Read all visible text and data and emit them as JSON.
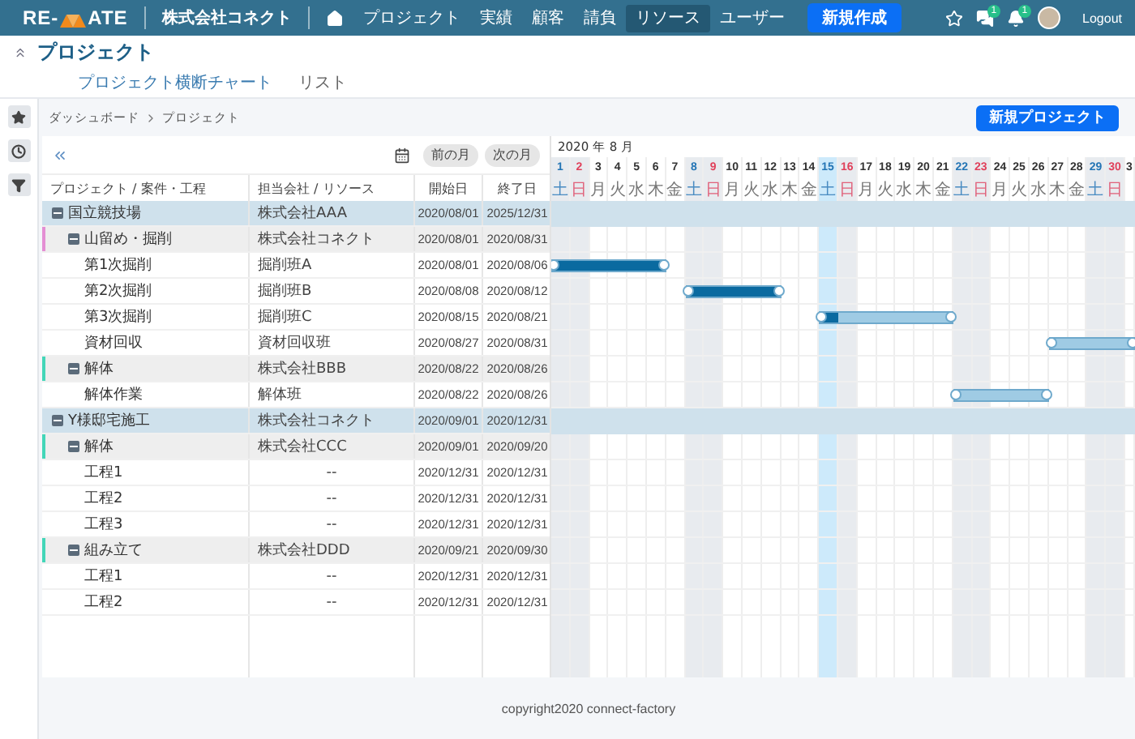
{
  "header": {
    "logo": {
      "left": "RE-",
      "right": "ATE"
    },
    "company": "株式会社コネクト",
    "nav": [
      {
        "label": "プロジェクト",
        "selected": false
      },
      {
        "label": "実績",
        "selected": false
      },
      {
        "label": "顧客",
        "selected": false
      },
      {
        "label": "請負",
        "selected": false
      },
      {
        "label": "リソース",
        "selected": true
      },
      {
        "label": "ユーザー",
        "selected": false
      }
    ],
    "create_button": "新規作成",
    "chat_badge": "1",
    "bell_badge": "1",
    "logout": "Logout"
  },
  "page": {
    "title": "プロジェクト",
    "tabs": [
      {
        "label": "プロジェクト横断チャート",
        "selected": true
      },
      {
        "label": "リスト",
        "selected": false
      }
    ]
  },
  "breadcrumb": [
    "ダッシュボード",
    "プロジェクト"
  ],
  "new_project_button": "新規プロジェクト",
  "toolbar": {
    "prev": "前の月",
    "next": "次の月"
  },
  "columns": [
    "プロジェクト / 案件・工程",
    "担当会社 / リソース",
    "開始日",
    "終了日"
  ],
  "month_label": "2020 年 8 月",
  "days": [
    {
      "day": "1",
      "weekday": "土",
      "kind": "saturday",
      "today": false
    },
    {
      "day": "2",
      "weekday": "日",
      "kind": "sunday",
      "today": false
    },
    {
      "day": "3",
      "weekday": "月",
      "kind": "weekday",
      "today": false
    },
    {
      "day": "4",
      "weekday": "火",
      "kind": "weekday",
      "today": false
    },
    {
      "day": "5",
      "weekday": "水",
      "kind": "weekday",
      "today": false
    },
    {
      "day": "6",
      "weekday": "木",
      "kind": "weekday",
      "today": false
    },
    {
      "day": "7",
      "weekday": "金",
      "kind": "weekday",
      "today": false
    },
    {
      "day": "8",
      "weekday": "土",
      "kind": "saturday",
      "today": false
    },
    {
      "day": "9",
      "weekday": "日",
      "kind": "sunday",
      "today": false
    },
    {
      "day": "10",
      "weekday": "月",
      "kind": "weekday",
      "today": false
    },
    {
      "day": "11",
      "weekday": "火",
      "kind": "weekday",
      "today": false
    },
    {
      "day": "12",
      "weekday": "水",
      "kind": "weekday",
      "today": false
    },
    {
      "day": "13",
      "weekday": "木",
      "kind": "weekday",
      "today": false
    },
    {
      "day": "14",
      "weekday": "金",
      "kind": "weekday",
      "today": false
    },
    {
      "day": "15",
      "weekday": "土",
      "kind": "saturday",
      "today": true
    },
    {
      "day": "16",
      "weekday": "日",
      "kind": "sunday",
      "today": false
    },
    {
      "day": "17",
      "weekday": "月",
      "kind": "weekday",
      "today": false
    },
    {
      "day": "18",
      "weekday": "火",
      "kind": "weekday",
      "today": false
    },
    {
      "day": "19",
      "weekday": "水",
      "kind": "weekday",
      "today": false
    },
    {
      "day": "20",
      "weekday": "木",
      "kind": "weekday",
      "today": false
    },
    {
      "day": "21",
      "weekday": "金",
      "kind": "weekday",
      "today": false
    },
    {
      "day": "22",
      "weekday": "土",
      "kind": "saturday",
      "today": false
    },
    {
      "day": "23",
      "weekday": "日",
      "kind": "sunday",
      "today": false
    },
    {
      "day": "24",
      "weekday": "月",
      "kind": "weekday",
      "today": false
    },
    {
      "day": "25",
      "weekday": "火",
      "kind": "weekday",
      "today": false
    },
    {
      "day": "26",
      "weekday": "水",
      "kind": "weekday",
      "today": false
    },
    {
      "day": "27",
      "weekday": "木",
      "kind": "weekday",
      "today": false
    },
    {
      "day": "28",
      "weekday": "金",
      "kind": "weekday",
      "today": false
    },
    {
      "day": "29",
      "weekday": "土",
      "kind": "saturday",
      "today": false
    },
    {
      "day": "30",
      "weekday": "日",
      "kind": "sunday",
      "today": false
    },
    {
      "day": "3",
      "kind": "weekday",
      "today": false
    }
  ],
  "projects": [
    {
      "kind": "project",
      "name": "国立競技場",
      "company": "株式会社AAA",
      "start": "2020/08/01",
      "end": "2025/12/31",
      "expanded": true,
      "children": [
        {
          "kind": "group",
          "name": "山留め・掘削",
          "company": "株式会社コネクト",
          "start": "2020/08/01",
          "end": "2020/08/31",
          "expanded": true,
          "color": "#e48fd4",
          "children": [
            {
              "kind": "task",
              "name": "第1次掘削",
              "company": "掘削班A",
              "start": "2020/08/01",
              "end": "2020/08/06",
              "level": 1
            },
            {
              "kind": "task",
              "name": "第2次掘削",
              "company": "掘削班B",
              "start": "2020/08/08",
              "end": "2020/08/12",
              "level": 1
            },
            {
              "kind": "task",
              "name": "第3次掘削",
              "company": "掘削班C",
              "start": "2020/08/15",
              "end": "2020/08/21",
              "level": 0.14
            },
            {
              "kind": "task",
              "name": "資材回収",
              "company": "資材回収班",
              "start": "2020/08/27",
              "end": "2020/08/31",
              "level": 0
            }
          ]
        },
        {
          "kind": "group",
          "name": "解体",
          "company": "株式会社BBB",
          "start": "2020/08/22",
          "end": "2020/08/26",
          "expanded": true,
          "color": "#43d6b8",
          "children": [
            {
              "kind": "task",
              "name": "解体作業",
              "company": "解体班",
              "start": "2020/08/22",
              "end": "2020/08/26",
              "level": 0
            }
          ]
        }
      ]
    },
    {
      "kind": "project",
      "name": "Y様邸宅施工",
      "company": "株式会社コネクト",
      "start": "2020/09/01",
      "end": "2020/12/31",
      "expanded": true,
      "children": [
        {
          "kind": "group",
          "name": "解体",
          "company": "株式会社CCC",
          "start": "2020/09/01",
          "end": "2020/09/20",
          "expanded": true,
          "color": "#43d6b8",
          "children": [
            {
              "kind": "task",
              "name": "工程1",
              "company": "--",
              "start": "2020/12/31",
              "end": "2020/12/31"
            },
            {
              "kind": "task",
              "name": "工程2",
              "company": "--",
              "start": "2020/12/31",
              "end": "2020/12/31"
            },
            {
              "kind": "task",
              "name": "工程3",
              "company": "--",
              "start": "2020/12/31",
              "end": "2020/12/31"
            }
          ]
        },
        {
          "kind": "group",
          "name": "組み立て",
          "company": "株式会社DDD",
          "start": "2020/09/21",
          "end": "2020/09/30",
          "expanded": true,
          "color": "#43d6b8",
          "children": [
            {
              "kind": "task",
              "name": "工程1",
              "company": "--",
              "start": "2020/12/31",
              "end": "2020/12/31"
            },
            {
              "kind": "task",
              "name": "工程2",
              "company": "--",
              "start": "2020/12/31",
              "end": "2020/12/31"
            }
          ]
        }
      ]
    }
  ],
  "footer": "copyright2020 connect-factory"
}
